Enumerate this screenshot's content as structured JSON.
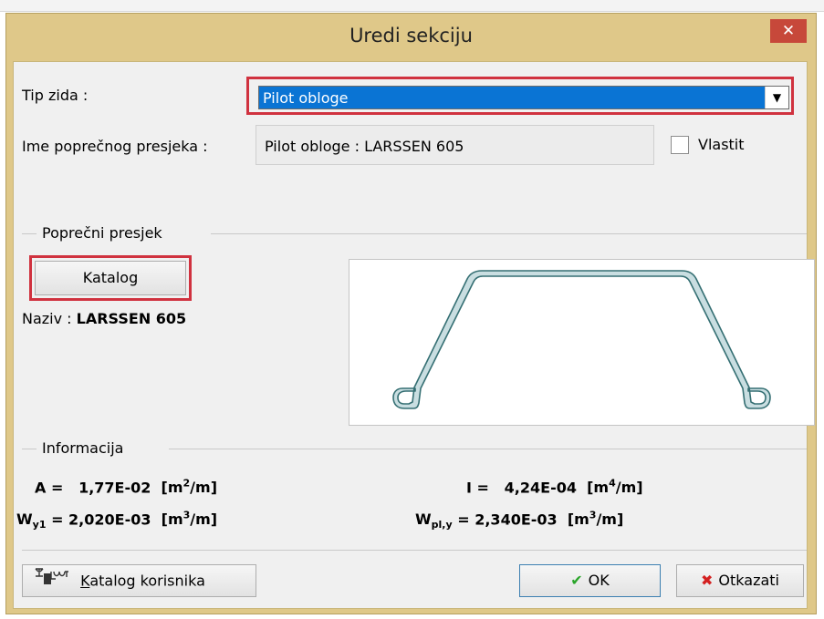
{
  "dialog": {
    "title": "Uredi sekciju",
    "close_symbol": "✕"
  },
  "wall_type": {
    "label": "Tip zida :",
    "selected": "Pilot obloge"
  },
  "section_name": {
    "label": "Ime poprečnog presjeka :",
    "value": "Pilot obloge : LARSSEN 605",
    "custom_label": "Vlastit"
  },
  "cross_section": {
    "group_title": "Poprečni presjek",
    "catalog_button": "Katalog",
    "name_label": "Naziv :",
    "name_value": "LARSSEN 605"
  },
  "information": {
    "group_title": "Informacija",
    "A": {
      "label": "A =",
      "value": "1,77E-02",
      "unit_open": "[m",
      "unit_exp": "2",
      "unit_close": "/m]"
    },
    "I": {
      "label": "I =",
      "value": "4,24E-04",
      "unit_open": "[m",
      "unit_exp": "4",
      "unit_close": "/m]"
    },
    "Wy1": {
      "label_main": "W",
      "label_sub": "y1",
      "eq": "=",
      "value": "2,020E-03",
      "unit_open": "[m",
      "unit_exp": "3",
      "unit_close": "/m]"
    },
    "Wply": {
      "label_main": "W",
      "label_sub": "pl,y",
      "eq": "=",
      "value": "2,340E-03",
      "unit_open": "[m",
      "unit_exp": "3",
      "unit_close": "/m]"
    }
  },
  "footer": {
    "user_catalog_first": "K",
    "user_catalog_rest": "atalog korisnika",
    "ok": "OK",
    "cancel": "Otkazati"
  },
  "colors": {
    "titlebar": "#dfc889",
    "highlight": "#d0323f",
    "selected_bg": "#0a74d4",
    "ok_check": "#2aa52a",
    "cancel_x": "#d42020",
    "profile_fill": "#c9dee1",
    "profile_stroke": "#356f73"
  }
}
